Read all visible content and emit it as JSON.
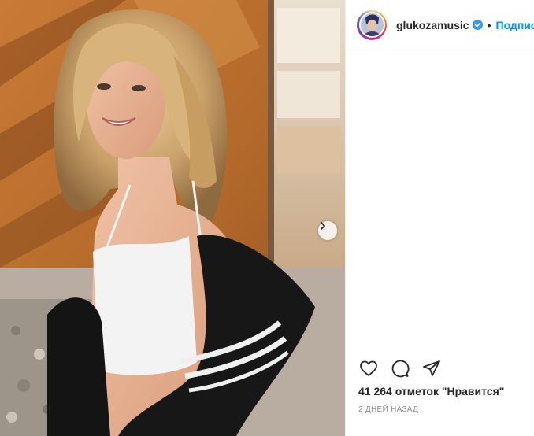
{
  "post": {
    "image_alt": "Фото глюкоза",
    "next_label": "Далее"
  },
  "header": {
    "username": "glukozamusic",
    "separator": "•",
    "follow_label": "Подписаться"
  },
  "stats": {
    "likes_text": "41 264 отметок \"Нравится\"",
    "time_text": "2 ДНЕЙ НАЗАД"
  },
  "colors": {
    "accent": "#0095f6",
    "text": "#262626",
    "muted": "#8e8e8e"
  },
  "icons": [
    "heart-icon",
    "comment-icon",
    "share-icon",
    "chevron-right-icon",
    "verified-badge-icon"
  ]
}
